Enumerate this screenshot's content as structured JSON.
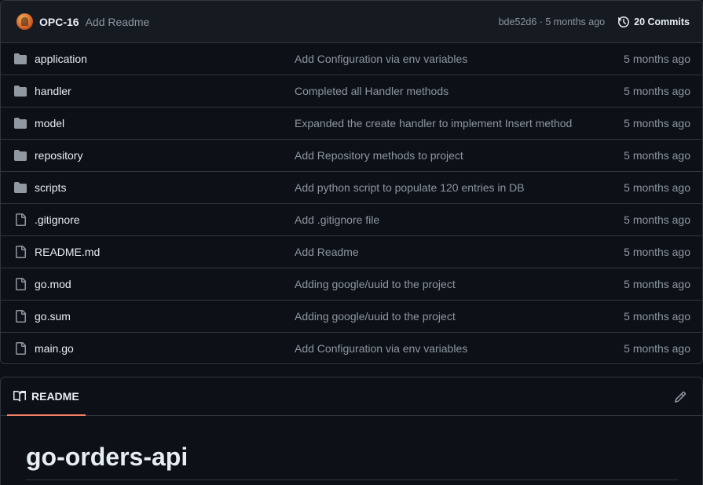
{
  "commit": {
    "author": "OPC-16",
    "message": "Add Readme",
    "meta": "bde52d6 · 5 months ago",
    "commits_label": "20 Commits"
  },
  "files": [
    {
      "name": "application",
      "type": "folder",
      "message": "Add Configuration via env variables",
      "age": "5 months ago"
    },
    {
      "name": "handler",
      "type": "folder",
      "message": "Completed all Handler methods",
      "age": "5 months ago"
    },
    {
      "name": "model",
      "type": "folder",
      "message": "Expanded the create handler to implement Insert method",
      "age": "5 months ago"
    },
    {
      "name": "repository",
      "type": "folder",
      "message": "Add Repository methods to project",
      "age": "5 months ago"
    },
    {
      "name": "scripts",
      "type": "folder",
      "message": "Add python script to populate 120 entries in DB",
      "age": "5 months ago"
    },
    {
      "name": ".gitignore",
      "type": "file",
      "message": "Add .gitignore file",
      "age": "5 months ago"
    },
    {
      "name": "README.md",
      "type": "file",
      "message": "Add Readme",
      "age": "5 months ago"
    },
    {
      "name": "go.mod",
      "type": "file",
      "message": "Adding google/uuid to the project",
      "age": "5 months ago"
    },
    {
      "name": "go.sum",
      "type": "file",
      "message": "Adding google/uuid to the project",
      "age": "5 months ago"
    },
    {
      "name": "main.go",
      "type": "file",
      "message": "Add Configuration via env variables",
      "age": "5 months ago"
    }
  ],
  "readme": {
    "tab_label": "README",
    "title": "go-orders-api"
  },
  "icons": {
    "folder": "folder-icon",
    "file": "file-icon",
    "history": "history-icon",
    "book": "book-icon",
    "edit": "pencil-icon"
  },
  "colors": {
    "background": "#0d1117",
    "header_bg": "#161b22",
    "border": "#30363d",
    "text": "#e6edf3",
    "muted": "#8d96a0",
    "folder": "#9198a1",
    "tab_underline": "#f78166"
  }
}
